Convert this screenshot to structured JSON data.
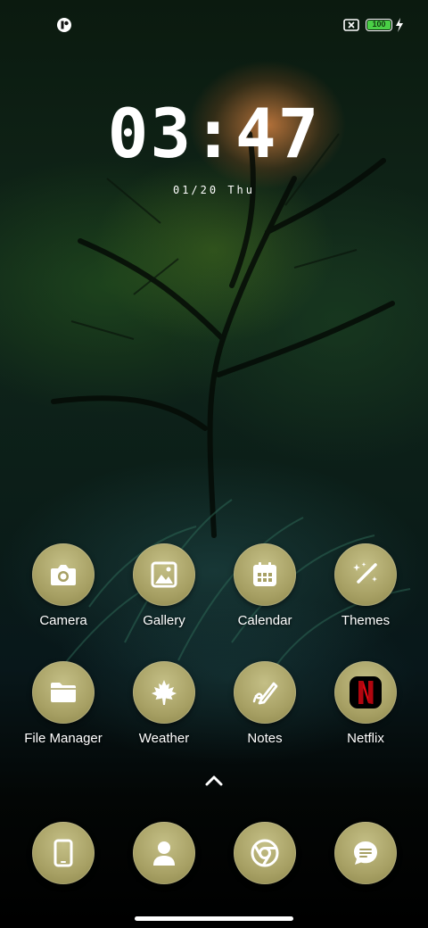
{
  "status_bar": {
    "battery_level": "100",
    "battery_color": "#4ad046",
    "icons": [
      "notification-icon",
      "battery-saver-x-icon",
      "battery-icon",
      "charging-bolt-icon"
    ]
  },
  "clock": {
    "time": "03:47",
    "date": "01/20 Thu"
  },
  "apps_row1": [
    {
      "label": "Camera",
      "icon": "camera-icon"
    },
    {
      "label": "Gallery",
      "icon": "gallery-icon"
    },
    {
      "label": "Calendar",
      "icon": "calendar-icon"
    },
    {
      "label": "Themes",
      "icon": "magic-wand-icon"
    }
  ],
  "apps_row2": [
    {
      "label": "File Manager",
      "icon": "folder-icon"
    },
    {
      "label": "Weather",
      "icon": "maple-leaf-icon"
    },
    {
      "label": "Notes",
      "icon": "pen-icon"
    },
    {
      "label": "Netflix",
      "icon": "netflix-icon"
    }
  ],
  "dock": [
    {
      "icon": "phone-icon"
    },
    {
      "icon": "contacts-icon"
    },
    {
      "icon": "chrome-icon"
    },
    {
      "icon": "messages-icon"
    }
  ],
  "icon_tint": "#a7a064",
  "netflix_red": "#e50914"
}
